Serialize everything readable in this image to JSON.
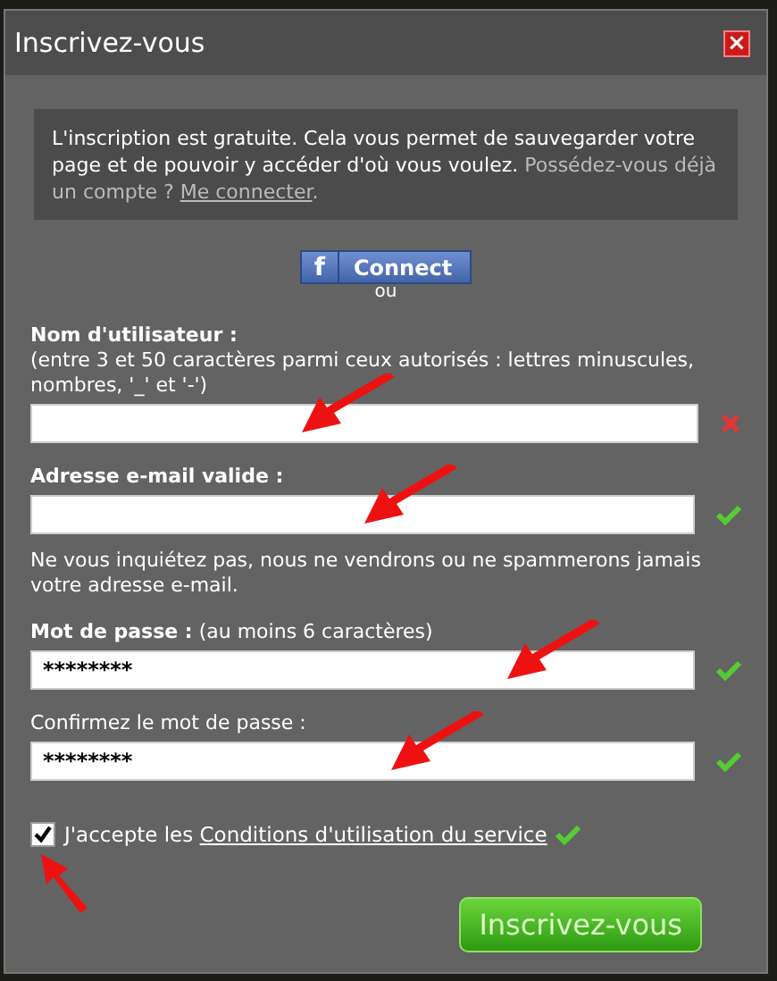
{
  "window": {
    "title": "Inscrivez-vous",
    "close": "×"
  },
  "info": {
    "text": "L'inscription est gratuite. Cela vous permet de sauvegarder votre page et de pouvoir y accéder d'où vous voulez.",
    "prompt": "Possédez-vous déjà un compte ?",
    "link": "Me connecter",
    "end": "."
  },
  "facebook": {
    "logo": "f",
    "label": "Connect",
    "separator": "ou"
  },
  "fields": [
    {
      "kind": "text",
      "label": "Nom d'utilisateur :",
      "label_bold": true,
      "hint": "(entre 3 et 50 caractères parmi ceux autorisés : lettres minuscules, nombres, '_' et '-')",
      "valid": false,
      "arrow": true
    },
    {
      "kind": "email",
      "label": "Adresse e-mail valide :",
      "label_bold": true,
      "note": "Ne vous inquiétez pas, nous ne vendrons ou ne spammerons jamais votre adresse e-mail.",
      "valid": true,
      "arrow": true
    },
    {
      "kind": "password",
      "label": "**Mot de passe :** (au moins 6 caractères)",
      "label_bold": false,
      "value": "********",
      "valid": true,
      "arrow": true
    },
    {
      "kind": "password",
      "label": "Confirmez le mot de passe :",
      "label_bold": false,
      "value": "********",
      "valid": true,
      "arrow": true
    }
  ],
  "terms": {
    "checked": true,
    "text": "J'accepte les",
    "link": "Conditions d'utilisation du service",
    "valid": true,
    "arrow": true
  },
  "submit": "Inscrivez-vous"
}
